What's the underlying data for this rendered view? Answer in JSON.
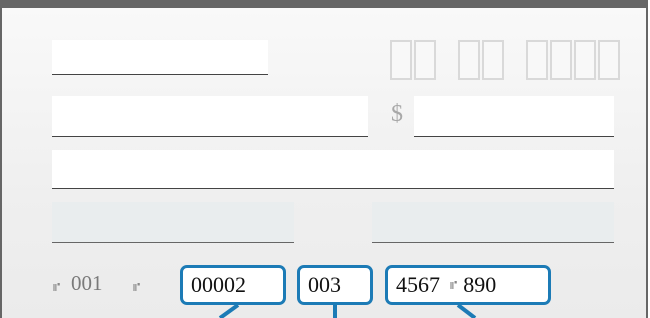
{
  "check": {
    "currency_symbol": "$",
    "micr": {
      "prefix_symbol": "⑈",
      "check_number": "001",
      "suffix_symbol": "⑈",
      "routing_box": "00002",
      "account_box": "003",
      "check_box_part1": "4567",
      "check_box_symbol": "⑈",
      "check_box_part2": "890"
    }
  },
  "colors": {
    "highlight_border": "#1c7bb6",
    "check_border": "#666666",
    "placeholder_box": "#d9d9d9"
  }
}
